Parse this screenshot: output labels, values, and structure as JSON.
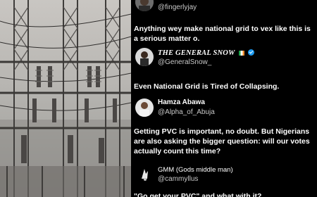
{
  "posts": [
    {
      "handle": "@fingerlyjay",
      "text": "Anything wey make national grid to vex like this is a serious matter o."
    },
    {
      "name": "THE GENERAL SNOW",
      "handle": "@GeneralSnow_",
      "text": "Even National Grid is Tired of Collapsing."
    },
    {
      "name": "Hamza Abawa",
      "handle": "@Alpha_of_Abuja",
      "text": "Getting PVC is important, no doubt. But Nigerians are also asking the bigger question: will our votes actually count this time?"
    },
    {
      "name": "GMM (Gods middle man)",
      "handle": "@cammyllus",
      "text": "\"Go get your PVC\" and what with it?"
    }
  ],
  "colors": {
    "background": "#000000",
    "handle": "#c8c8c8",
    "verified": "#1d9bf0",
    "flag_green": "#1fa24a",
    "flag_orange": "#f28c28"
  }
}
